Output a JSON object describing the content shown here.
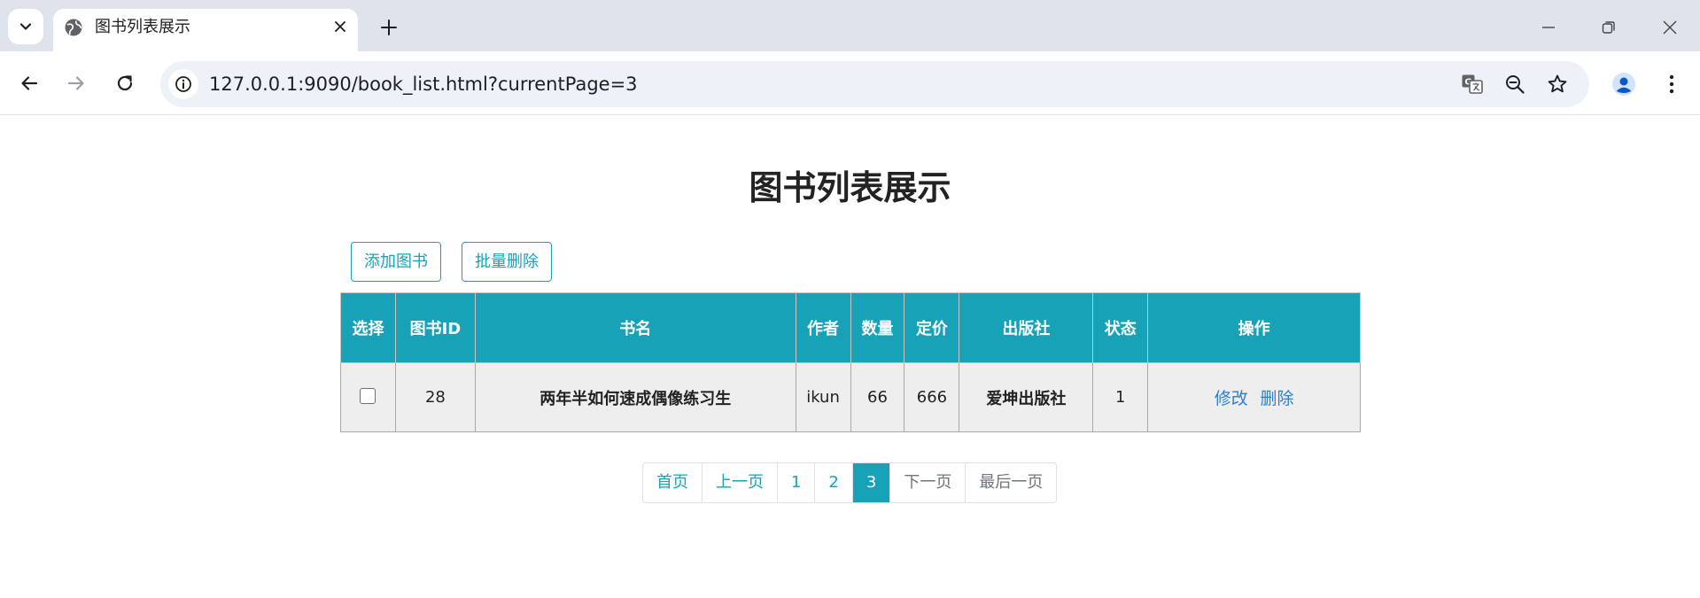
{
  "browser": {
    "tab_title": "图书列表展示",
    "url": "127.0.0.1:9090/book_list.html?currentPage=3"
  },
  "page": {
    "title": "图书列表展示",
    "buttons": {
      "add": "添加图书",
      "batch_delete": "批量删除"
    },
    "table": {
      "headers": [
        "选择",
        "图书ID",
        "书名",
        "作者",
        "数量",
        "定价",
        "出版社",
        "状态",
        "操作"
      ],
      "rows": [
        {
          "id": "28",
          "name": "两年半如何速成偶像练习生",
          "author": "ikun",
          "count": "66",
          "price": "666",
          "publisher": "爱坤出版社",
          "status": "1",
          "edit": "修改",
          "delete": "删除"
        }
      ]
    },
    "pagination": {
      "first": "首页",
      "prev": "上一页",
      "pages": [
        "1",
        "2",
        "3"
      ],
      "current": "3",
      "next": "下一页",
      "last": "最后一页"
    }
  },
  "colors": {
    "accent": "#17a2b8",
    "link": "#2b7fd4"
  }
}
